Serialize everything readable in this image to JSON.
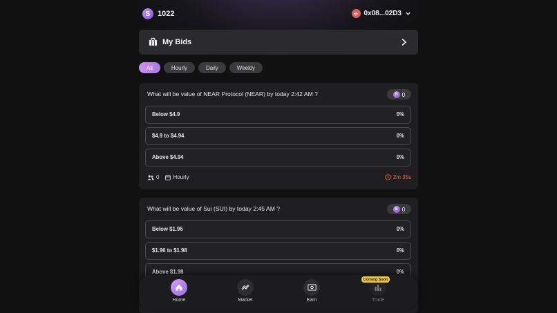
{
  "header": {
    "coin_symbol": "S",
    "balance": "1022",
    "wallet_address": "0x08...02D3"
  },
  "my_bids": {
    "label": "My Bids"
  },
  "filters": [
    {
      "label": "All",
      "active": true
    },
    {
      "label": "Hourly",
      "active": false
    },
    {
      "label": "Daily",
      "active": false
    },
    {
      "label": "Weekly",
      "active": false
    }
  ],
  "markets": [
    {
      "question": "What will be value of NEAR Protocol (NEAR) by today 2:42 AM ?",
      "pool": "0",
      "options": [
        {
          "label": "Below $4.9",
          "percent": "0%"
        },
        {
          "label": "$4.9 to $4.94",
          "percent": "0%"
        },
        {
          "label": "Above $4.94",
          "percent": "0%"
        }
      ],
      "participants": "0",
      "frequency": "Hourly",
      "time_left": "2m 35s"
    },
    {
      "question": "What will be value of Sui (SUI) by today 2:45 AM ?",
      "pool": "0",
      "options": [
        {
          "label": "Below $1.96",
          "percent": "0%"
        },
        {
          "label": "$1.96 to $1.98",
          "percent": "0%"
        },
        {
          "label": "Above $1.98",
          "percent": "0%"
        }
      ]
    }
  ],
  "nav": {
    "home": "Home",
    "market": "Market",
    "earn": "Earn",
    "trade": "Trade",
    "coming_soon": "Coming Soon"
  },
  "colors": {
    "accent": "#c58cf0",
    "timer": "#e86a3a",
    "coming_soon": "#f2c531",
    "wallet_avatar": "#e35a54"
  }
}
